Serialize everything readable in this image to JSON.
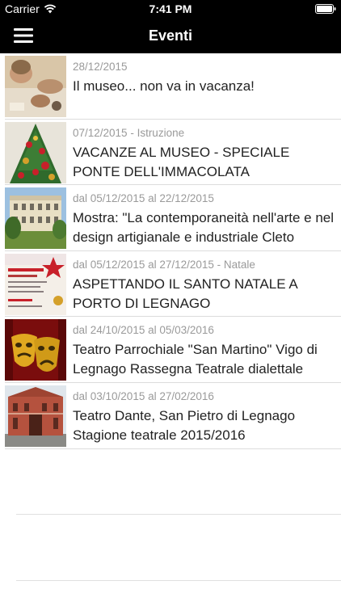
{
  "status_bar": {
    "carrier": "Carrier",
    "time": "7:41 PM"
  },
  "nav": {
    "title": "Eventi",
    "menu_icon": "hamburger-menu-icon"
  },
  "events": [
    {
      "date": "28/12/2015",
      "title": "Il museo... non va in vacanza!",
      "thumb": "children-crafts-photo"
    },
    {
      "date": "07/12/2015 - Istruzione",
      "title": "VACANZE AL MUSEO - SPECIALE PONTE DELL'IMMACOLATA",
      "thumb": "christmas-tree-photo"
    },
    {
      "date": "dal 05/12/2015 al 22/12/2015",
      "title": "Mostra: \"La contemporaneità nell'arte e nel design artigianale e industriale Cleto",
      "thumb": "villa-building-photo"
    },
    {
      "date": "dal 05/12/2015 al 27/12/2015 - Natale",
      "title": "ASPETTANDO IL SANTO NATALE A PORTO DI LEGNAGO",
      "thumb": "christmas-flyer-photo"
    },
    {
      "date": "dal 24/10/2015 al 05/03/2016",
      "title": "Teatro Parrochiale \"San Martino\" Vigo di Legnago Rassegna Teatrale dialettale",
      "thumb": "theatre-masks-photo"
    },
    {
      "date": "dal 03/10/2015 al 27/02/2016",
      "title": "Teatro Dante, San Pietro di Legnago Stagione teatrale 2015/2016",
      "thumb": "theatre-building-photo"
    }
  ]
}
